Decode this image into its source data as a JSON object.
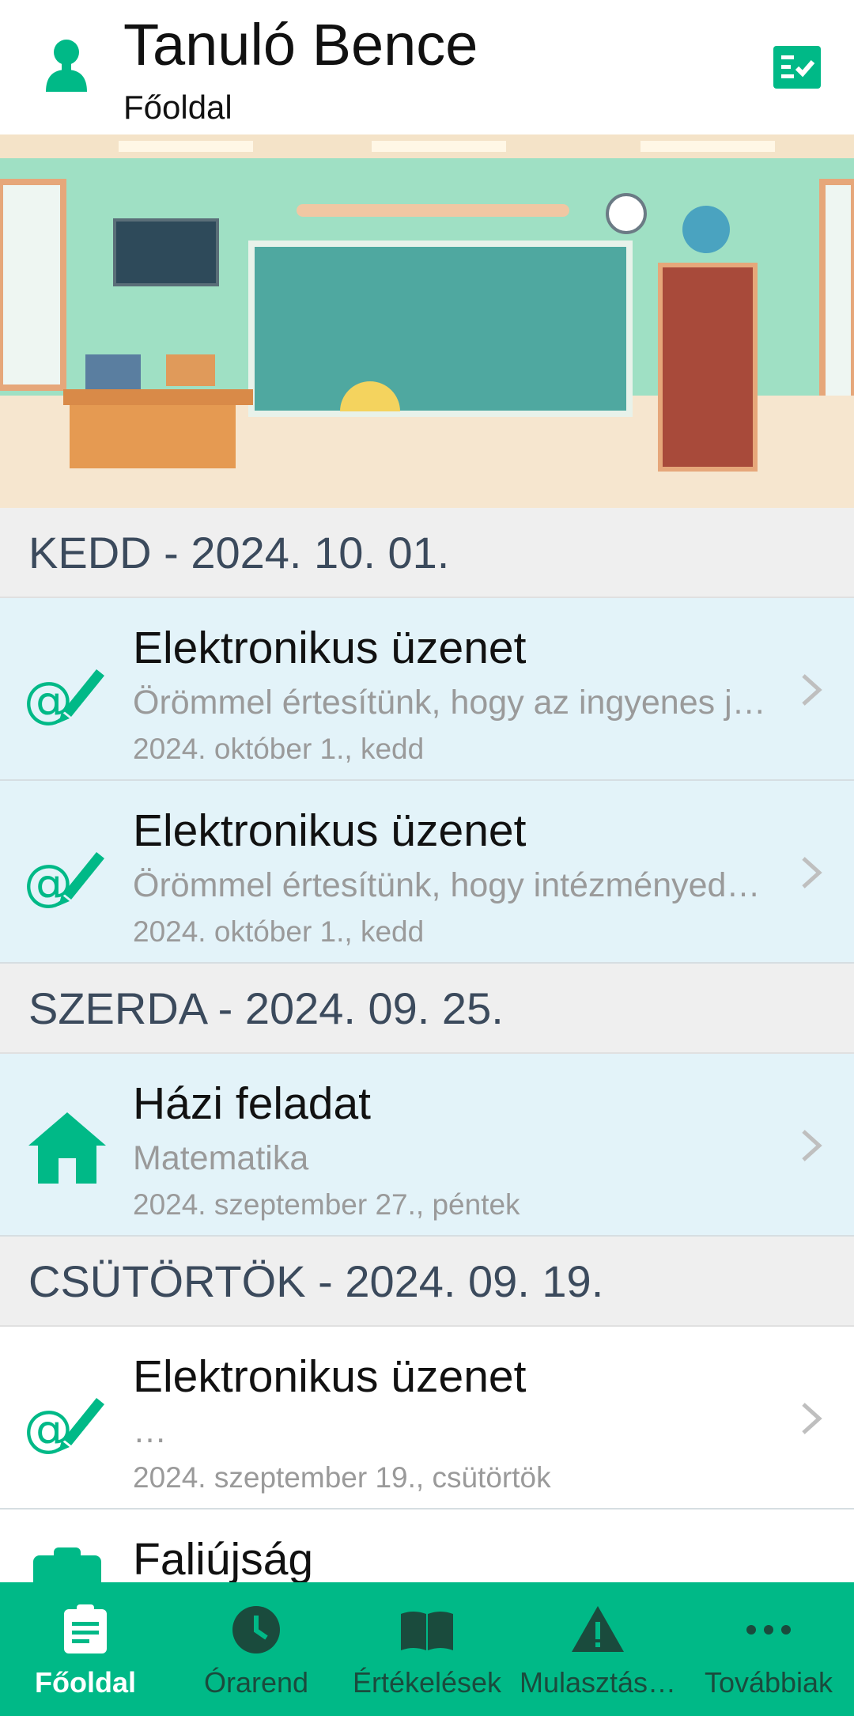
{
  "header": {
    "title": "Tanuló Bence",
    "subtitle": "Főoldal"
  },
  "colors": {
    "accent": "#00b987",
    "section_bg": "#efefef",
    "unread_bg": "#e3f3f9",
    "text_muted": "#9a9a9a"
  },
  "sections": [
    {
      "date": "KEDD - 2024. 10. 01.",
      "items": [
        {
          "type": "message",
          "icon": "at-pencil-icon",
          "title": "Elektronikus üzenet",
          "subtitle": "Örömmel értesítünk, hogy az ingyenes j…",
          "date": "2024. október 1., kedd",
          "unread": true
        },
        {
          "type": "message",
          "icon": "at-pencil-icon",
          "title": "Elektronikus üzenet",
          "subtitle": "Örömmel értesítünk, hogy intézményed…",
          "date": "2024. október 1., kedd",
          "unread": true
        }
      ]
    },
    {
      "date": "SZERDA - 2024. 09. 25.",
      "items": [
        {
          "type": "homework",
          "icon": "home-icon",
          "title": "Házi feladat",
          "subtitle": "Matematika",
          "date": "2024. szeptember 27., péntek",
          "unread": true
        }
      ]
    },
    {
      "date": "CSÜTÖRTÖK - 2024. 09. 19.",
      "items": [
        {
          "type": "message",
          "icon": "at-pencil-icon",
          "title": "Elektronikus üzenet",
          "subtitle": " …",
          "date": "2024. szeptember 19., csütörtök",
          "unread": false
        },
        {
          "type": "noticeboard",
          "icon": "clipboard-icon",
          "title": "Faliújság",
          "subtitle": "",
          "date": "",
          "unread": false
        }
      ]
    }
  ],
  "bottom_nav": [
    {
      "label": "Főoldal",
      "icon": "clipboard-icon",
      "active": true
    },
    {
      "label": "Órarend",
      "icon": "clock-icon",
      "active": false
    },
    {
      "label": "Értékelések",
      "icon": "book-icon",
      "active": false
    },
    {
      "label": "Mulasztás…",
      "icon": "warning-icon",
      "active": false
    },
    {
      "label": "Továbbiak",
      "icon": "more-icon",
      "active": false
    }
  ]
}
